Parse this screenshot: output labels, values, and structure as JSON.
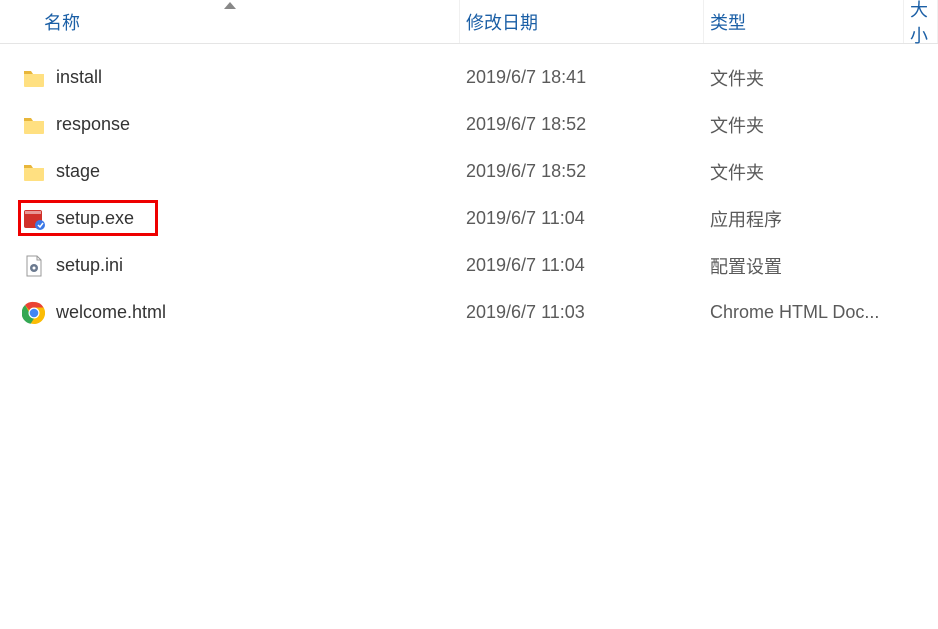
{
  "columns": {
    "name": "名称",
    "modified": "修改日期",
    "type": "类型",
    "size": "大小"
  },
  "rows": [
    {
      "icon": "folder",
      "name": "install",
      "modified": "2019/6/7 18:41",
      "type": "文件夹"
    },
    {
      "icon": "folder",
      "name": "response",
      "modified": "2019/6/7 18:52",
      "type": "文件夹"
    },
    {
      "icon": "folder",
      "name": "stage",
      "modified": "2019/6/7 18:52",
      "type": "文件夹"
    },
    {
      "icon": "exe",
      "name": "setup.exe",
      "modified": "2019/6/7 11:04",
      "type": "应用程序"
    },
    {
      "icon": "ini",
      "name": "setup.ini",
      "modified": "2019/6/7 11:04",
      "type": "配置设置"
    },
    {
      "icon": "chrome",
      "name": "welcome.html",
      "modified": "2019/6/7 11:03",
      "type": "Chrome HTML Doc..."
    }
  ],
  "highlighted_row_index": 3
}
